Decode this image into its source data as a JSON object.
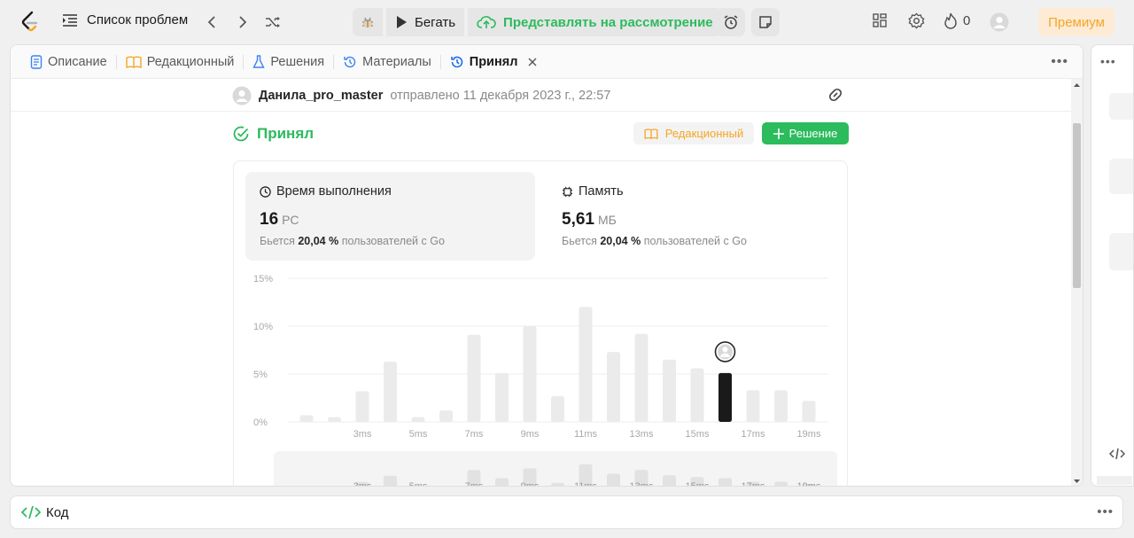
{
  "topbar": {
    "problem_list": "Список проблем",
    "run": "Бегать",
    "submit": "Представлять на рассмотрение",
    "streak_count": "0",
    "premium": "Премиум"
  },
  "tabs": [
    {
      "label": "Описание"
    },
    {
      "label": "Редакционный"
    },
    {
      "label": "Решения"
    },
    {
      "label": "Материалы"
    },
    {
      "label": "Принял"
    }
  ],
  "submission": {
    "username": "Данила_pro_master",
    "submitted_text": "отправлено 11 декабря 2023 г., 22:57",
    "status": "Принял",
    "editorial_button": "Редакционный",
    "solution_button": "Решение"
  },
  "runtime": {
    "title": "Время выполнения",
    "value": "16",
    "unit": "РС",
    "beats_prefix": "Бьется",
    "beats_value": "20,04 %",
    "beats_suffix": "пользователей с Go"
  },
  "memory": {
    "title": "Память",
    "value": "5,61",
    "unit": "МБ",
    "beats_prefix": "Бьется",
    "beats_value": "20,04 %",
    "beats_suffix": "пользователей с Go"
  },
  "chart_data": {
    "type": "bar",
    "x": [
      1,
      2,
      3,
      4,
      5,
      6,
      7,
      8,
      9,
      10,
      11,
      12,
      13,
      14,
      15,
      16,
      17,
      18,
      19
    ],
    "values": [
      0.7,
      0.5,
      3.2,
      6.3,
      0.5,
      1.2,
      9.1,
      5.1,
      10.0,
      2.7,
      12.0,
      7.3,
      9.2,
      6.5,
      5.6,
      5.1,
      3.3,
      3.3,
      2.2
    ],
    "highlight_index": 15,
    "ytick_labels": [
      "0%",
      "5%",
      "10%",
      "15%"
    ],
    "ylim": [
      0,
      15
    ],
    "xtick_labels": [
      "3ms",
      "5ms",
      "7ms",
      "9ms",
      "11ms",
      "13ms",
      "15ms",
      "17ms",
      "19ms"
    ],
    "xticks_at": [
      3,
      5,
      7,
      9,
      11,
      13,
      15,
      17,
      19
    ],
    "grid": true,
    "bar_color": "#ebebeb",
    "highlight_color": "#1a1a1a"
  },
  "code_panel": {
    "label": "Код"
  },
  "colors": {
    "accent_green": "#2cbb5d",
    "premium_orange": "#f5a623"
  }
}
